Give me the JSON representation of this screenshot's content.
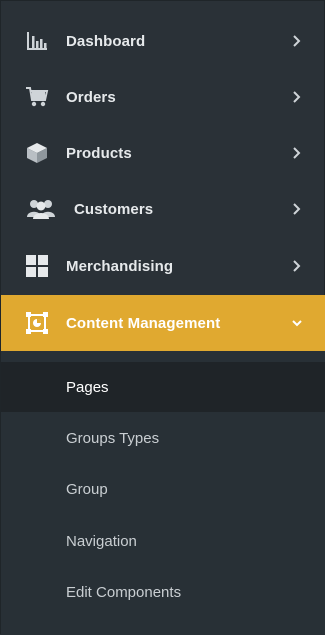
{
  "colors": {
    "sidebar_bg": "#2a3137",
    "active_bg": "#e0a930",
    "selected_sub_bg": "#1f2428",
    "icon": "#cfd4d8",
    "text": "#e6e9eb",
    "sub_text": "#c9ced2"
  },
  "menu": [
    {
      "label": "Dashboard",
      "icon": "bar-chart-icon",
      "chevron": "chevron-right-icon"
    },
    {
      "label": "Orders",
      "icon": "cart-icon",
      "chevron": "chevron-right-icon"
    },
    {
      "label": "Products",
      "icon": "box-icon",
      "chevron": "chevron-right-icon"
    },
    {
      "label": "Customers",
      "icon": "users-icon",
      "chevron": "chevron-right-icon"
    },
    {
      "label": "Merchandising",
      "icon": "grid-icon",
      "chevron": "chevron-right-icon"
    },
    {
      "label": "Content Management",
      "icon": "content-frame-icon",
      "chevron": "chevron-down-icon",
      "active": true
    }
  ],
  "submenu": [
    {
      "label": "Pages",
      "selected": true
    },
    {
      "label": "Groups Types"
    },
    {
      "label": "Group"
    },
    {
      "label": "Navigation"
    },
    {
      "label": "Edit Components"
    }
  ]
}
